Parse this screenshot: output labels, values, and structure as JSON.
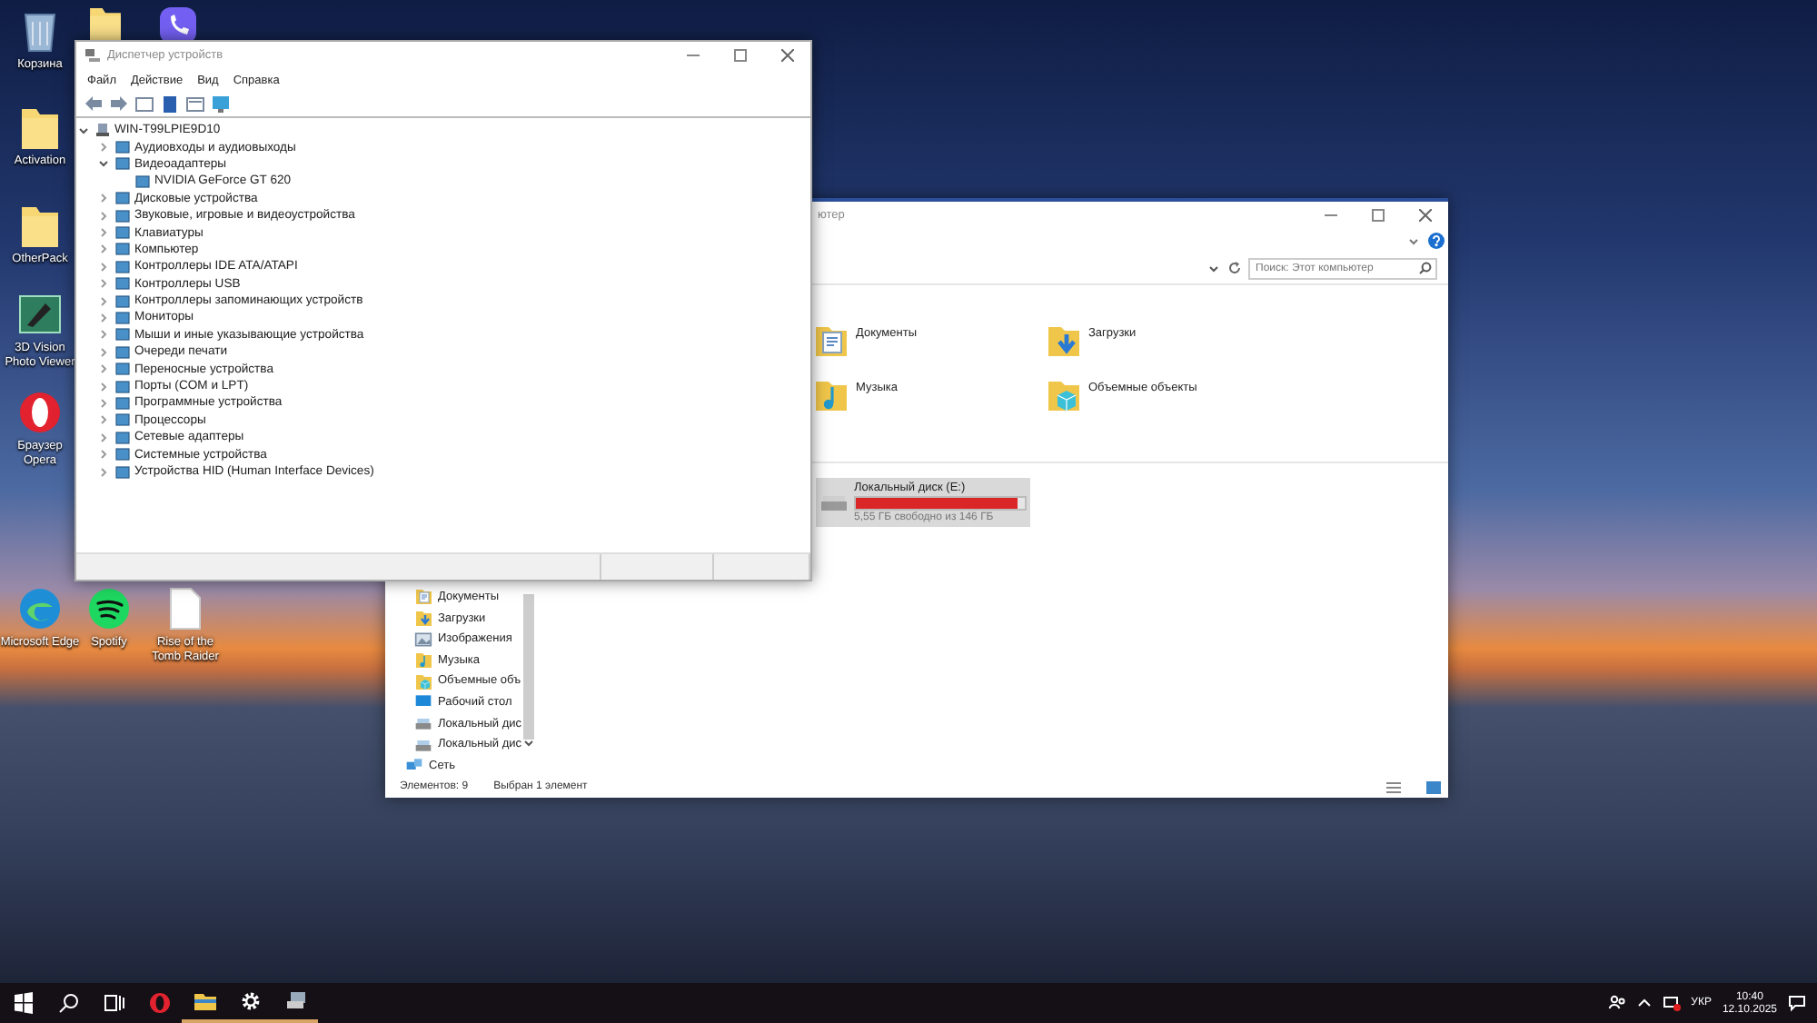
{
  "desktop_icons": [
    {
      "label": "Корзина",
      "kind": "bin"
    },
    {
      "label": "Activation",
      "kind": "folder"
    },
    {
      "label": "OtherPack",
      "kind": "folder"
    },
    {
      "label": "3D Vision Photo Viewer",
      "kind": "viewer"
    },
    {
      "label": "Браузер Opera",
      "kind": "opera"
    },
    {
      "label": "Microsoft Edge",
      "kind": "edge"
    },
    {
      "label": "Spotify",
      "kind": "spotify"
    },
    {
      "label": "Rise of the Tomb Raider",
      "kind": "file"
    }
  ],
  "device_manager": {
    "title": "Диспетчер устройств",
    "menu": [
      "Файл",
      "Действие",
      "Вид",
      "Справка"
    ],
    "tree": [
      {
        "label": "WIN-T99LPIE9D10",
        "expanded": true,
        "children": [
          {
            "label": "Аудиовходы и аудиовыходы",
            "expanded": false
          },
          {
            "label": "Видеоадаптеры",
            "expanded": true,
            "children": [
              {
                "label": "NVIDIA GeForce GT 620"
              }
            ]
          },
          {
            "label": "Дисковые устройства",
            "expanded": false
          },
          {
            "label": "Звуковые, игровые и видеоустройства",
            "expanded": false
          },
          {
            "label": "Клавиатуры",
            "expanded": false
          },
          {
            "label": "Компьютер",
            "expanded": false
          },
          {
            "label": "Контроллеры IDE ATA/ATAPI",
            "expanded": false
          },
          {
            "label": "Контроллеры USB",
            "expanded": false
          },
          {
            "label": "Контроллеры запоминающих устройств",
            "expanded": false
          },
          {
            "label": "Мониторы",
            "expanded": false
          },
          {
            "label": "Мыши и иные указывающие устройства",
            "expanded": false
          },
          {
            "label": "Очереди печати",
            "expanded": false
          },
          {
            "label": "Переносные устройства",
            "expanded": false
          },
          {
            "label": "Порты (COM и LPT)",
            "expanded": false
          },
          {
            "label": "Программные устройства",
            "expanded": false
          },
          {
            "label": "Процессоры",
            "expanded": false
          },
          {
            "label": "Сетевые адаптеры",
            "expanded": false
          },
          {
            "label": "Системные устройства",
            "expanded": false
          },
          {
            "label": "Устройства HID (Human Interface Devices)",
            "expanded": false
          }
        ]
      }
    ]
  },
  "explorer": {
    "title": "ютер",
    "search": {
      "placeholder": "Поиск: Этот компьютер"
    },
    "folders": [
      {
        "label": "Документы",
        "kind": "documents"
      },
      {
        "label": "Загрузки",
        "kind": "downloads"
      },
      {
        "label": "Музыка",
        "kind": "music"
      },
      {
        "label": "Объемные объекты",
        "kind": "objects3d"
      }
    ],
    "drives": [
      {
        "label": "Локальный диск (E:)",
        "level": 0.96,
        "reading": "5,55 ГБ свободно из 146 ГБ",
        "selected": true
      }
    ],
    "nav": [
      {
        "label": "Документы",
        "kind": "documents"
      },
      {
        "label": "Загрузки",
        "kind": "downloads"
      },
      {
        "label": "Изображения",
        "kind": "pictures"
      },
      {
        "label": "Музыка",
        "kind": "music"
      },
      {
        "label": "Объемные объ",
        "kind": "objects3d"
      },
      {
        "label": "Рабочий стол",
        "kind": "desktop"
      },
      {
        "label": "Локальный дис",
        "kind": "drive"
      },
      {
        "label": "Локальный дис",
        "kind": "drive"
      },
      {
        "label": "Сеть",
        "kind": "network"
      }
    ],
    "status": [
      "Элементов: 9",
      "Выбран 1 элемент"
    ]
  },
  "taskbar": {
    "apps": [
      {
        "kind": "opera",
        "running": false
      },
      {
        "kind": "explorer",
        "running": true
      },
      {
        "kind": "settings",
        "running": true
      },
      {
        "kind": "devices",
        "running": true
      }
    ],
    "language": "УКР",
    "time": "10:40",
    "date": "12.10.2025"
  }
}
